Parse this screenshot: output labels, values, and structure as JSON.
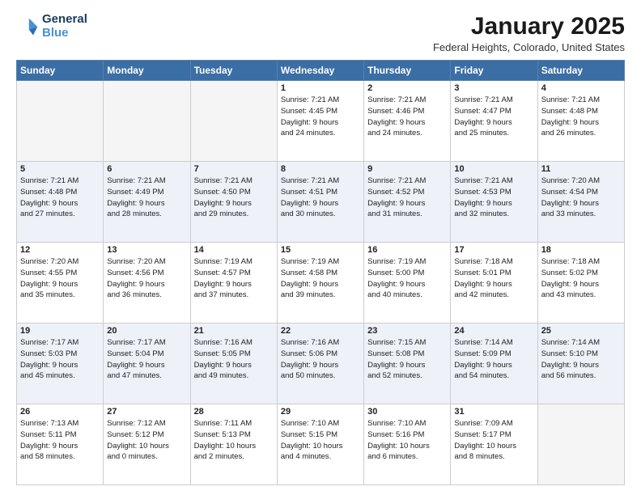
{
  "header": {
    "logo_line1": "General",
    "logo_line2": "Blue",
    "month": "January 2025",
    "location": "Federal Heights, Colorado, United States"
  },
  "days_of_week": [
    "Sunday",
    "Monday",
    "Tuesday",
    "Wednesday",
    "Thursday",
    "Friday",
    "Saturday"
  ],
  "weeks": [
    [
      {
        "day": "",
        "info": ""
      },
      {
        "day": "",
        "info": ""
      },
      {
        "day": "",
        "info": ""
      },
      {
        "day": "1",
        "info": "Sunrise: 7:21 AM\nSunset: 4:45 PM\nDaylight: 9 hours\nand 24 minutes."
      },
      {
        "day": "2",
        "info": "Sunrise: 7:21 AM\nSunset: 4:46 PM\nDaylight: 9 hours\nand 24 minutes."
      },
      {
        "day": "3",
        "info": "Sunrise: 7:21 AM\nSunset: 4:47 PM\nDaylight: 9 hours\nand 25 minutes."
      },
      {
        "day": "4",
        "info": "Sunrise: 7:21 AM\nSunset: 4:48 PM\nDaylight: 9 hours\nand 26 minutes."
      }
    ],
    [
      {
        "day": "5",
        "info": "Sunrise: 7:21 AM\nSunset: 4:48 PM\nDaylight: 9 hours\nand 27 minutes."
      },
      {
        "day": "6",
        "info": "Sunrise: 7:21 AM\nSunset: 4:49 PM\nDaylight: 9 hours\nand 28 minutes."
      },
      {
        "day": "7",
        "info": "Sunrise: 7:21 AM\nSunset: 4:50 PM\nDaylight: 9 hours\nand 29 minutes."
      },
      {
        "day": "8",
        "info": "Sunrise: 7:21 AM\nSunset: 4:51 PM\nDaylight: 9 hours\nand 30 minutes."
      },
      {
        "day": "9",
        "info": "Sunrise: 7:21 AM\nSunset: 4:52 PM\nDaylight: 9 hours\nand 31 minutes."
      },
      {
        "day": "10",
        "info": "Sunrise: 7:21 AM\nSunset: 4:53 PM\nDaylight: 9 hours\nand 32 minutes."
      },
      {
        "day": "11",
        "info": "Sunrise: 7:20 AM\nSunset: 4:54 PM\nDaylight: 9 hours\nand 33 minutes."
      }
    ],
    [
      {
        "day": "12",
        "info": "Sunrise: 7:20 AM\nSunset: 4:55 PM\nDaylight: 9 hours\nand 35 minutes."
      },
      {
        "day": "13",
        "info": "Sunrise: 7:20 AM\nSunset: 4:56 PM\nDaylight: 9 hours\nand 36 minutes."
      },
      {
        "day": "14",
        "info": "Sunrise: 7:19 AM\nSunset: 4:57 PM\nDaylight: 9 hours\nand 37 minutes."
      },
      {
        "day": "15",
        "info": "Sunrise: 7:19 AM\nSunset: 4:58 PM\nDaylight: 9 hours\nand 39 minutes."
      },
      {
        "day": "16",
        "info": "Sunrise: 7:19 AM\nSunset: 5:00 PM\nDaylight: 9 hours\nand 40 minutes."
      },
      {
        "day": "17",
        "info": "Sunrise: 7:18 AM\nSunset: 5:01 PM\nDaylight: 9 hours\nand 42 minutes."
      },
      {
        "day": "18",
        "info": "Sunrise: 7:18 AM\nSunset: 5:02 PM\nDaylight: 9 hours\nand 43 minutes."
      }
    ],
    [
      {
        "day": "19",
        "info": "Sunrise: 7:17 AM\nSunset: 5:03 PM\nDaylight: 9 hours\nand 45 minutes."
      },
      {
        "day": "20",
        "info": "Sunrise: 7:17 AM\nSunset: 5:04 PM\nDaylight: 9 hours\nand 47 minutes."
      },
      {
        "day": "21",
        "info": "Sunrise: 7:16 AM\nSunset: 5:05 PM\nDaylight: 9 hours\nand 49 minutes."
      },
      {
        "day": "22",
        "info": "Sunrise: 7:16 AM\nSunset: 5:06 PM\nDaylight: 9 hours\nand 50 minutes."
      },
      {
        "day": "23",
        "info": "Sunrise: 7:15 AM\nSunset: 5:08 PM\nDaylight: 9 hours\nand 52 minutes."
      },
      {
        "day": "24",
        "info": "Sunrise: 7:14 AM\nSunset: 5:09 PM\nDaylight: 9 hours\nand 54 minutes."
      },
      {
        "day": "25",
        "info": "Sunrise: 7:14 AM\nSunset: 5:10 PM\nDaylight: 9 hours\nand 56 minutes."
      }
    ],
    [
      {
        "day": "26",
        "info": "Sunrise: 7:13 AM\nSunset: 5:11 PM\nDaylight: 9 hours\nand 58 minutes."
      },
      {
        "day": "27",
        "info": "Sunrise: 7:12 AM\nSunset: 5:12 PM\nDaylight: 10 hours\nand 0 minutes."
      },
      {
        "day": "28",
        "info": "Sunrise: 7:11 AM\nSunset: 5:13 PM\nDaylight: 10 hours\nand 2 minutes."
      },
      {
        "day": "29",
        "info": "Sunrise: 7:10 AM\nSunset: 5:15 PM\nDaylight: 10 hours\nand 4 minutes."
      },
      {
        "day": "30",
        "info": "Sunrise: 7:10 AM\nSunset: 5:16 PM\nDaylight: 10 hours\nand 6 minutes."
      },
      {
        "day": "31",
        "info": "Sunrise: 7:09 AM\nSunset: 5:17 PM\nDaylight: 10 hours\nand 8 minutes."
      },
      {
        "day": "",
        "info": ""
      }
    ]
  ]
}
